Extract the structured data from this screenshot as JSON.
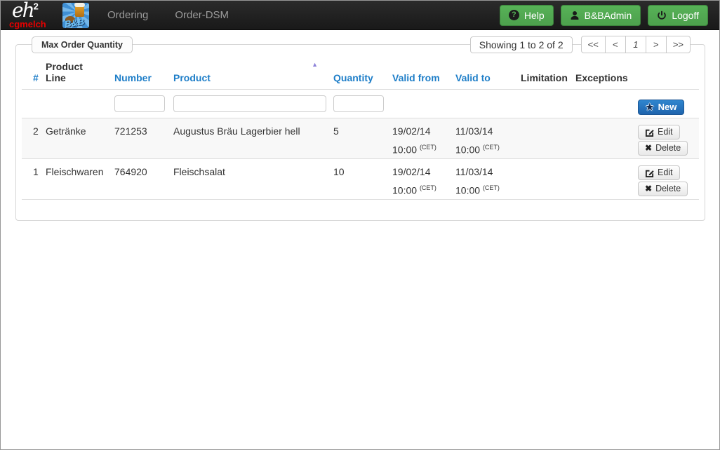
{
  "navbar": {
    "logo": {
      "word": "eh",
      "sup": "2",
      "company": "cgmelch"
    },
    "brand_badge": "B&B",
    "nav_items": [
      {
        "label": "Ordering"
      },
      {
        "label": "Order-DSM"
      }
    ],
    "actions": [
      {
        "label": "Help",
        "icon": "question-circle-icon"
      },
      {
        "label": "B&BAdmin",
        "icon": "user-icon"
      },
      {
        "label": "Logoff",
        "icon": "power-icon"
      }
    ]
  },
  "page": {
    "tab_label": "Max Order Quantity",
    "paging": {
      "status": "Showing 1 to 2 of 2",
      "first": "<<",
      "prev": "<",
      "current": "1",
      "next": ">",
      "last": ">>"
    }
  },
  "table": {
    "headers": {
      "index": "#",
      "product_line": "Product Line",
      "number": "Number",
      "product": "Product",
      "quantity": "Quantity",
      "valid_from": "Valid from",
      "valid_to": "Valid to",
      "limitation": "Limitation",
      "exceptions": "Exceptions"
    },
    "sort": {
      "column": "product",
      "direction": "ascending",
      "glyph": "▲"
    },
    "new_label": "New",
    "row_actions": {
      "edit": "Edit",
      "delete": "Delete"
    },
    "rows": [
      {
        "index": "2",
        "product_line": "Getränke",
        "number": "721253",
        "product": "Augustus Bräu Lagerbier hell",
        "quantity": "5",
        "valid_from": {
          "date": "19/02/14",
          "time": "10:00",
          "tz": "(CET)"
        },
        "valid_to": {
          "date": "11/03/14",
          "time": "10:00",
          "tz": "(CET)"
        },
        "limitation": "",
        "exceptions": ""
      },
      {
        "index": "1",
        "product_line": "Fleischwaren",
        "number": "764920",
        "product": "Fleischsalat",
        "quantity": "10",
        "valid_from": {
          "date": "19/02/14",
          "time": "10:00",
          "tz": "(CET)"
        },
        "valid_to": {
          "date": "11/03/14",
          "time": "10:00",
          "tz": "(CET)"
        },
        "limitation": "",
        "exceptions": ""
      }
    ]
  },
  "icons": {
    "delete_glyph": "✖",
    "new_star": "★",
    "help_glyph": "?"
  },
  "colors": {
    "navbar_bg": "#222222",
    "link_blue": "#1e7ec8",
    "button_green": "#57b257",
    "new_button_blue": "#2a7ac4",
    "sort_indicator": "#8d82d9",
    "logo_red": "#e60000",
    "row_stripe": "#f8f8f8"
  }
}
